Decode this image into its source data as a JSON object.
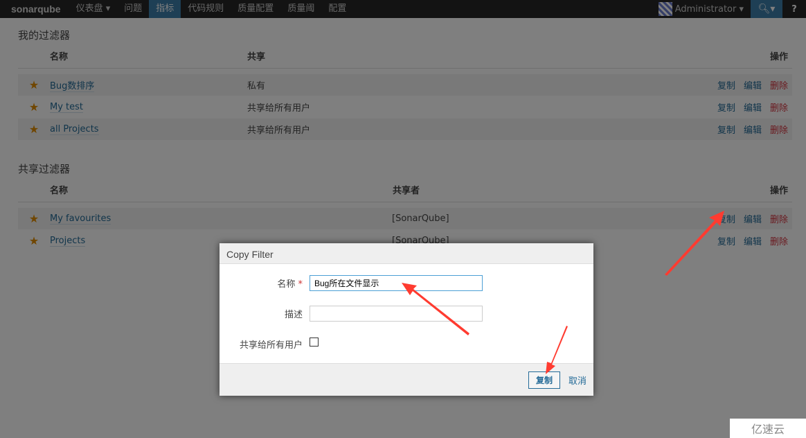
{
  "nav": {
    "logo": "sonarqube",
    "items": [
      {
        "label": "仪表盘 ▾"
      },
      {
        "label": "问题"
      },
      {
        "label": "指标",
        "active": true
      },
      {
        "label": "代码规则"
      },
      {
        "label": "质量配置"
      },
      {
        "label": "质量阈"
      },
      {
        "label": "配置"
      }
    ],
    "user": "Administrator ▾",
    "search_icon": "search-icon",
    "help": "?"
  },
  "my_filters": {
    "title": "我的过滤器",
    "headers": {
      "name": "名称",
      "share": "共享",
      "ops": "操作"
    },
    "rows": [
      {
        "name": "Bug数排序",
        "share": "私有"
      },
      {
        "name": "My test",
        "share": "共享给所有用户"
      },
      {
        "name": "all Projects",
        "share": "共享给所有用户"
      }
    ]
  },
  "shared_filters": {
    "title": "共享过滤器",
    "headers": {
      "name": "名称",
      "sharer": "共享者",
      "ops": "操作"
    },
    "rows": [
      {
        "name": "My favourites",
        "sharer": "[SonarQube]"
      },
      {
        "name": "Projects",
        "sharer": "[SonarQube]"
      }
    ]
  },
  "ops": {
    "copy": "复制",
    "edit": "编辑",
    "delete": "删除"
  },
  "modal": {
    "title": "Copy Filter",
    "name_label": "名称",
    "required": "*",
    "name_value": "Bug所在文件显示",
    "desc_label": "描述",
    "desc_value": "",
    "share_label": "共享给所有用户",
    "share_checked": false,
    "submit": "复制",
    "cancel": "取消"
  },
  "watermark": "亿速云",
  "colors": {
    "accent": "#3d7eaa",
    "link": "#236a97",
    "delete": "#d4333f",
    "star": "#e08c00",
    "annotation": "#ff3b30"
  }
}
